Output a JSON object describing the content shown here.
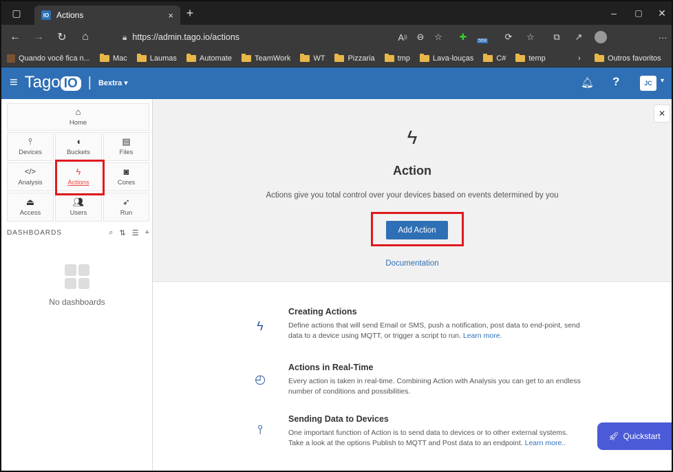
{
  "browser": {
    "tab_title": "Actions",
    "tab_favicon": "IO",
    "tab_close": "×",
    "new_tab": "+",
    "url": "https://admin.tago.io/actions",
    "extension_badge": "559",
    "bookmarks": [
      "Quando você fica n...",
      "Mac",
      "Laumas",
      "Automate",
      "TeamWork",
      "WT",
      "Pizzaria",
      "tmp",
      "Lava-louças",
      "C#",
      "temp"
    ],
    "other_favorites": "Outros favoritos"
  },
  "appbar": {
    "logo_text": "Tago",
    "logo_io": "IO",
    "account": "Bextra ▾",
    "avatar": "JC"
  },
  "sidebar": {
    "tiles": [
      {
        "label": "Home",
        "icon": "home-icon"
      },
      {
        "label": "Devices",
        "icon": "device-icon"
      },
      {
        "label": "Buckets",
        "icon": "bucket-icon"
      },
      {
        "label": "Files",
        "icon": "files-icon"
      },
      {
        "label": "Analysis",
        "icon": "code-icon"
      },
      {
        "label": "Actions",
        "icon": "bolt-icon"
      },
      {
        "label": "Cores",
        "icon": "cores-icon"
      },
      {
        "label": "Access",
        "icon": "lock-icon"
      },
      {
        "label": "Users",
        "icon": "users-icon"
      },
      {
        "label": "Run",
        "icon": "rocket-icon"
      }
    ],
    "dashboards_heading": "DASHBOARDS",
    "no_dashboards": "No dashboards"
  },
  "hero": {
    "title": "Action",
    "description": "Actions give you total control over your devices based on events determined by you",
    "add_button": "Add Action",
    "documentation": "Documentation"
  },
  "features": [
    {
      "title": "Creating Actions",
      "text": "Define actions that will send Email or SMS, push a notification, post data to end-point, send data to a device using MQTT, or trigger a script to run. ",
      "link": "Learn more."
    },
    {
      "title": "Actions in Real-Time",
      "text": "Every action is taken in real-time. Combining Action with Analysis you can get to an endless number of conditions and possibilities.",
      "link": ""
    },
    {
      "title": "Sending Data to Devices",
      "text": "One important function of Action is to send data to devices or to other external systems. Take a look at the options Publish to MQTT and Post data to an endpoint. ",
      "link": "Learn more."
    }
  ],
  "features_suffix": ".",
  "quickstart": "Quickstart",
  "colors": {
    "primary": "#2f6fb5",
    "highlight": "#e0191e",
    "active": "#e44444",
    "quickstart": "#4b5ad6"
  }
}
